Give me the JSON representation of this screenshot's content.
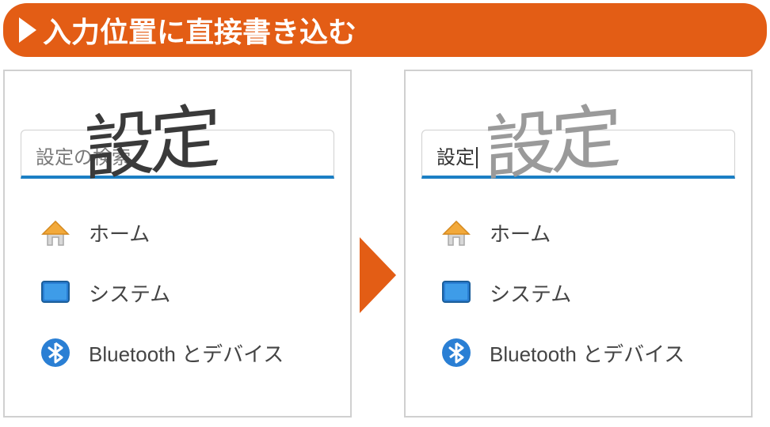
{
  "header": {
    "title": "入力位置に直接書き込む"
  },
  "panels": {
    "left": {
      "search_placeholder": "設定の検索",
      "handwriting": "設定"
    },
    "right": {
      "search_entered": "設定",
      "handwriting": "設定"
    }
  },
  "menu": {
    "home": "ホーム",
    "system": "システム",
    "bluetooth": "Bluetooth とデバイス"
  }
}
